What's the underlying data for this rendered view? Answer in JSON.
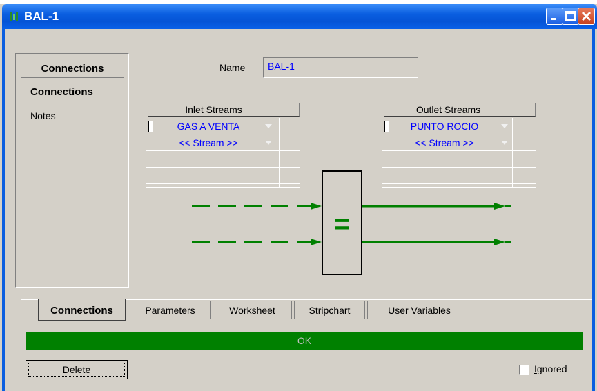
{
  "window": {
    "title": "BAL-1"
  },
  "sidebar": {
    "header": "Connections",
    "items": [
      "Connections",
      "Notes"
    ]
  },
  "name_field": {
    "label_underlined": "N",
    "label_rest": "ame",
    "value": "BAL-1"
  },
  "inlet": {
    "header": "Inlet Streams",
    "rows": [
      "GAS A VENTA",
      "<< Stream >>"
    ]
  },
  "outlet": {
    "header": "Outlet Streams",
    "rows": [
      "PUNTO ROCIO",
      "<< Stream >>"
    ]
  },
  "unit_symbol": "=",
  "tabs": [
    "Connections",
    "Parameters",
    "Worksheet",
    "Stripchart",
    "User Variables"
  ],
  "active_tab": "Connections",
  "status": {
    "text": "OK",
    "color": "#008000"
  },
  "buttons": {
    "delete": "Delete"
  },
  "ignored": {
    "label_underlined": "I",
    "label_rest": "gnored",
    "checked": false
  },
  "colors": {
    "titlebar": "#0a5ee0",
    "stream_text": "#0000ff",
    "stream_line": "#008000"
  }
}
